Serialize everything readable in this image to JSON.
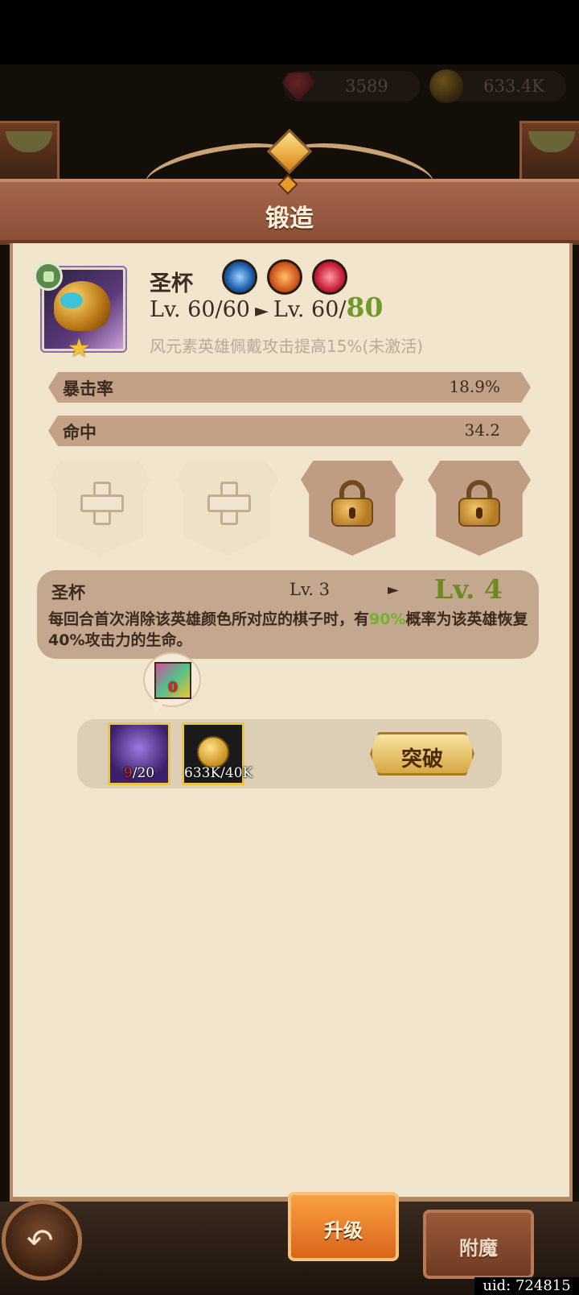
{
  "hud": {
    "gems": "3589",
    "gold": "633.4K",
    "gem_icon": "ruby-gem-icon",
    "gold_icon": "gold-coin-icon"
  },
  "header": {
    "title": "锻造"
  },
  "item": {
    "name": "圣杯",
    "level_current": "Lv. 60/60",
    "level_next_prefix": "Lv. 60/",
    "level_next_max": "80",
    "bonus": "风元素英雄佩戴攻击提高15%(未激活)",
    "stars": 1
  },
  "stats": [
    {
      "label": "暴击率",
      "value": "18.9%"
    },
    {
      "label": "命中",
      "value": "34.2"
    }
  ],
  "slots": [
    "open",
    "open",
    "locked",
    "locked"
  ],
  "skill": {
    "name": "圣杯",
    "level": "Lv. 3",
    "arrow": "►",
    "next_level": "Lv. 4",
    "desc_1": "每回合首次消除该英雄颜色所对应的棋子时，有",
    "desc_pct1": "90%",
    "desc_2": "概率为该英雄恢复40%攻击力的生命。"
  },
  "materials": {
    "crystal_count": "0",
    "stone_have": "9",
    "stone_need": "/20",
    "gold_count": "633K/40K",
    "break_label": "突破"
  },
  "tabs": {
    "upgrade": "升级",
    "enchant": "附魔"
  },
  "uid": "uid: 724815",
  "colors": {
    "accent_green": "#77b030",
    "header_brown": "#9a5a40",
    "parchment": "#f1e5cd"
  }
}
